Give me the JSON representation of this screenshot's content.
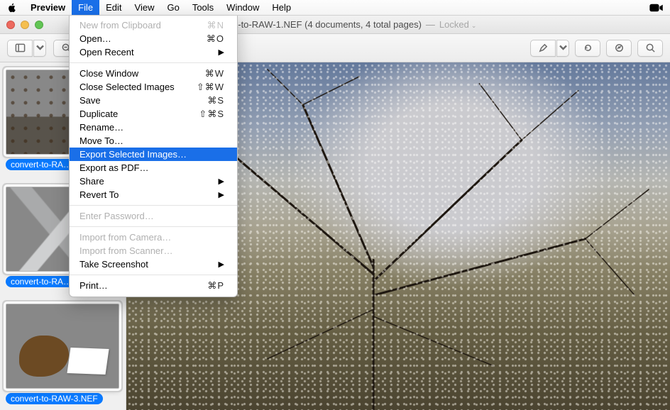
{
  "menubar": {
    "app": "Preview",
    "items": [
      "File",
      "Edit",
      "View",
      "Go",
      "Tools",
      "Window",
      "Help"
    ],
    "open_index": 0
  },
  "dropdown": {
    "groups": [
      [
        {
          "label": "New from Clipboard",
          "shortcut": "⌘N",
          "disabled": true
        },
        {
          "label": "Open…",
          "shortcut": "⌘O"
        },
        {
          "label": "Open Recent",
          "submenu": true
        }
      ],
      [
        {
          "label": "Close Window",
          "shortcut": "⌘W"
        },
        {
          "label": "Close Selected Images",
          "shortcut": "⇧⌘W"
        },
        {
          "label": "Save",
          "shortcut": "⌘S"
        },
        {
          "label": "Duplicate",
          "shortcut": "⇧⌘S"
        },
        {
          "label": "Rename…"
        },
        {
          "label": "Move To…"
        },
        {
          "label": "Export Selected Images…",
          "selected": true
        },
        {
          "label": "Export as PDF…"
        },
        {
          "label": "Share",
          "submenu": true
        },
        {
          "label": "Revert To",
          "submenu": true
        }
      ],
      [
        {
          "label": "Enter Password…",
          "disabled": true
        }
      ],
      [
        {
          "label": "Import from Camera…",
          "disabled": true
        },
        {
          "label": "Import from Scanner…",
          "disabled": true
        },
        {
          "label": "Take Screenshot",
          "submenu": true
        }
      ],
      [
        {
          "label": "Print…",
          "shortcut": "⌘P"
        }
      ]
    ]
  },
  "window": {
    "title": "convert-to-RAW-1.NEF (4 documents, 4 total pages)",
    "locked": "Locked"
  },
  "toolbar": {
    "sidebar_btn": "sidebar",
    "zoom_out": "zoom-out",
    "zoom_in": "zoom-in",
    "highlight": "highlight",
    "rotate": "rotate",
    "markup": "markup",
    "search": "search"
  },
  "sidebar": {
    "thumbs": [
      {
        "caption": "convert-to-RA…",
        "scene": "scene-tree",
        "selected": true
      },
      {
        "caption": "convert-to-RA…",
        "scene": "scene-mount",
        "selected": true
      },
      {
        "caption": "convert-to-RAW-3.NEF",
        "scene": "scene-bird",
        "selected": true
      }
    ]
  }
}
